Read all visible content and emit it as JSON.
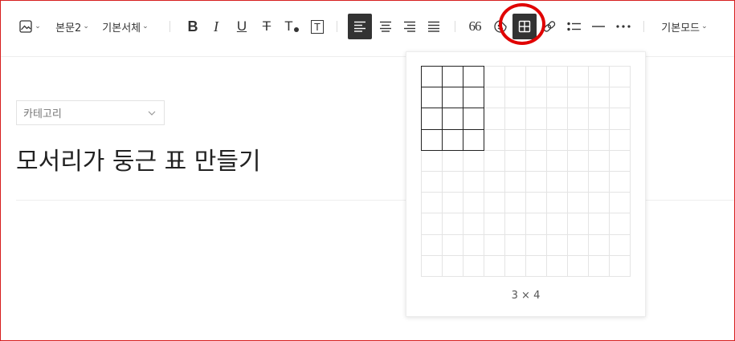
{
  "toolbar": {
    "image_button": {
      "icon": "image-icon",
      "has_dropdown": true
    },
    "paragraph_style": "본문2",
    "font_family": "기본서체",
    "format_buttons": [
      {
        "name": "bold-icon",
        "glyph": "B"
      },
      {
        "name": "italic-icon",
        "glyph": "I"
      },
      {
        "name": "underline-icon",
        "glyph": "U"
      },
      {
        "name": "strikethrough-icon",
        "glyph": "T"
      },
      {
        "name": "text-color-icon",
        "glyph": "T"
      },
      {
        "name": "text-background-icon",
        "glyph": "T"
      }
    ],
    "align_buttons": [
      "align-left-icon",
      "align-center-icon",
      "align-right-icon",
      "align-justify-icon"
    ],
    "active_align": "align-left-icon",
    "insert_buttons": [
      "quote-icon",
      "emoji-icon",
      "table-icon",
      "link-icon",
      "list-icon",
      "horizontal-line-icon",
      "more-icon"
    ],
    "quote_glyph": "66",
    "active_insert": "table-icon",
    "highlight_color": "#e00000",
    "mode": "기본모드"
  },
  "editor": {
    "category_placeholder": "카테고리",
    "title": "모서리가 둥근 표 만들기"
  },
  "table_picker": {
    "rows": 10,
    "cols": 10,
    "selected_rows": 4,
    "selected_cols": 3,
    "size_label": "3 × 4"
  },
  "colors": {
    "accent_dark": "#333333",
    "frame_border": "#d61f1f",
    "grid_line": "#e4e4e4",
    "grid_selected": "#222222"
  }
}
